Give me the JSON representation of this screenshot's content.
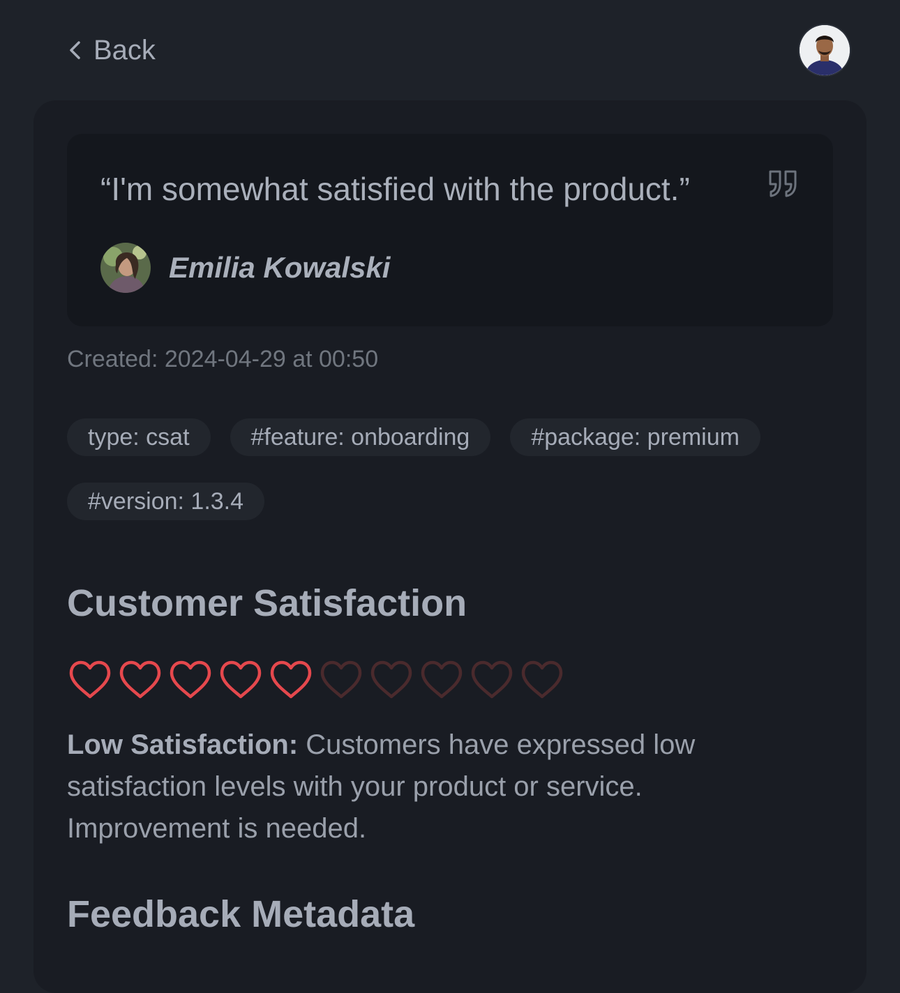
{
  "header": {
    "back_label": "Back"
  },
  "quote": {
    "text": "“I'm somewhat satisfied with the product.”",
    "author": "Emilia Kowalski"
  },
  "created": "Created: 2024-04-29 at 00:50",
  "tags": [
    "type: csat",
    "#feature: onboarding",
    "#package: premium",
    "#version: 1.3.4"
  ],
  "satisfaction": {
    "title": "Customer Satisfaction",
    "rating": 5,
    "max_rating": 10,
    "filled_color": "#e5484d",
    "empty_color": "#4a2a2d",
    "label": "Low Satisfaction:",
    "description": " Customers have expressed low satisfaction levels with your product or service. Improvement is needed."
  },
  "metadata": {
    "title": "Feedback Metadata"
  }
}
